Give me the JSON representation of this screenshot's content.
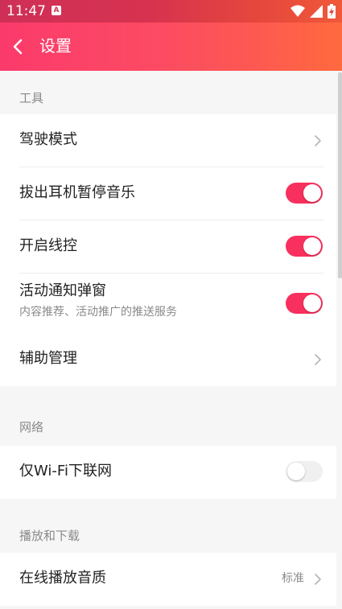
{
  "status_bar": {
    "time": "11:47",
    "notification_letter": "A",
    "icons": [
      "wifi-icon",
      "signal-icon",
      "battery-charging-icon"
    ]
  },
  "app_bar": {
    "title": "设置",
    "back_icon": "chevron-left-icon"
  },
  "sections": {
    "tools": {
      "label": "工具",
      "items": [
        {
          "label": "驾驶模式",
          "control": "chevron"
        },
        {
          "label": "拔出耳机暂停音乐",
          "control": "toggle",
          "on": true
        },
        {
          "label": "开启线控",
          "control": "toggle",
          "on": true
        },
        {
          "label": "活动通知弹窗",
          "sub": "内容推荐、活动推广的推送服务",
          "control": "toggle",
          "on": true
        },
        {
          "label": "辅助管理",
          "control": "chevron"
        }
      ]
    },
    "network": {
      "label": "网络",
      "items": [
        {
          "label": "仅Wi-Fi下联网",
          "control": "toggle",
          "on": false
        }
      ]
    },
    "playback": {
      "label": "播放和下载",
      "items": [
        {
          "label": "在线播放音质",
          "value": "标准",
          "control": "chevron"
        }
      ]
    }
  },
  "colors": {
    "accent": "#f8305e",
    "header_start": "#fb3a6c",
    "header_end": "#ff6a3e",
    "background": "#f6f6f6"
  }
}
